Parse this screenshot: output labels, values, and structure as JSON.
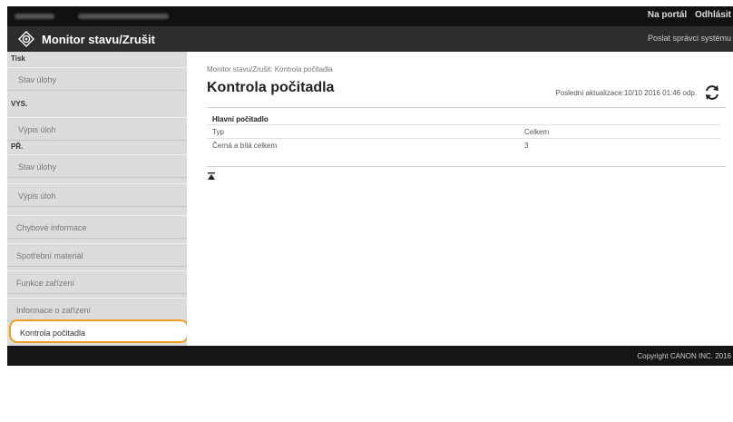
{
  "top_bar": {
    "portal_link": "Na portál",
    "logout_link": "Odhlásit"
  },
  "header": {
    "title": "Monitor stavu/Zrušit",
    "admin_link": "Poslat správci systému",
    "logo_icon": "canon-logo-icon"
  },
  "sidebar": {
    "sections": [
      {
        "heading": "Tisk",
        "items": [
          "Stav úlohy"
        ]
      },
      {
        "heading": "VYS.",
        "items": [
          "Výpis úloh"
        ]
      },
      {
        "heading": "PŘ.",
        "items": [
          "Stav úlohy",
          "Výpis úloh"
        ]
      }
    ],
    "items": [
      "Chybové informace",
      "Spotřební materiál",
      "Funkce zařízení",
      "Informace o zařízení",
      "Kontrola počitadla"
    ],
    "active": "Kontrola počitadla",
    "highlight_color": "#f0a020"
  },
  "main": {
    "breadcrumb": "Monitor stavu/Zrušit: Kontrola počitadla",
    "title": "Kontrola počitadla",
    "last_update": "Poslední aktualizace:10/10 2016 01:46 odp.",
    "counter_section": "Hlavní počitadlo",
    "table": {
      "headers": [
        "Typ",
        "Celkem"
      ],
      "rows": [
        [
          "Černá a bílá celkem",
          "3"
        ]
      ]
    },
    "icons": [
      "refresh-icon",
      "scroll-top-icon"
    ]
  },
  "footer": {
    "copyright": "Copyright CANON INC. 2016"
  }
}
